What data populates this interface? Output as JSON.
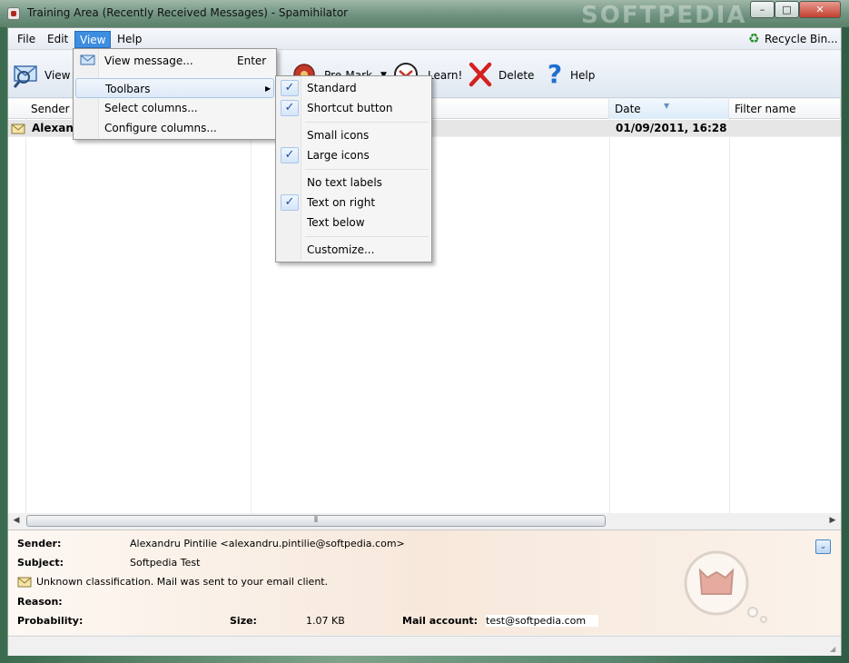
{
  "window": {
    "title": "Training Area (Recently Received Messages) - Spamihilator",
    "watermark": "SOFTPEDIA",
    "minimize_glyph": "–",
    "maximize_glyph": "□",
    "close_glyph": "✕"
  },
  "menubar": {
    "items": [
      "File",
      "Edit",
      "View",
      "Help"
    ],
    "active": "View",
    "recycle_label": "Recycle Bin..."
  },
  "toolbar": {
    "view_label": "View m",
    "premark_label": "Pre-Mark",
    "learn_label": "Learn!",
    "delete_label": "Delete",
    "help_label": "Help"
  },
  "list": {
    "columns": [
      "Sender",
      "Date",
      "Filter name"
    ],
    "sorted_column": "Date",
    "rows": [
      {
        "sender": "Alexand",
        "date": "01/09/2011, 16:28",
        "filter": ""
      }
    ]
  },
  "hscroll": {
    "left_arrow": "◀",
    "right_arrow": "▶",
    "thumb_grip": "⦀"
  },
  "details": {
    "sender_label": "Sender:",
    "sender_value": "Alexandru Pintilie <alexandru.pintilie@softpedia.com>",
    "subject_label": "Subject:",
    "subject_value": "Softpedia Test",
    "classification_text": "Unknown classification. Mail was sent to your email client.",
    "reason_label": "Reason:",
    "probability_label": "Probability:",
    "size_label": "Size:",
    "size_value": "1.07 KB",
    "account_label": "Mail account:",
    "account_value": "test@softpedia.com",
    "expand_glyph": "⌄"
  },
  "view_menu": {
    "items": [
      {
        "label": "View message...",
        "shortcut": "Enter"
      },
      {
        "label": "Toolbars",
        "submenu": true
      },
      {
        "label": "Select columns..."
      },
      {
        "label": "Configure columns..."
      }
    ],
    "submenu_arrow": "▶"
  },
  "toolbars_submenu": {
    "items": [
      {
        "label": "Standard",
        "checked": true
      },
      {
        "label": "Shortcut button",
        "checked": true
      },
      {
        "label": "Small icons",
        "checked": false
      },
      {
        "label": "Large icons",
        "checked": true
      },
      {
        "label": "No text labels",
        "checked": false
      },
      {
        "label": "Text on right",
        "checked": true
      },
      {
        "label": "Text below",
        "checked": false
      },
      {
        "label": "Customize...",
        "checked": false
      }
    ],
    "check_glyph": "✓"
  },
  "colors": {
    "menu_highlight": "#3d8ee0",
    "delete_red": "#d42020",
    "help_blue": "#1f6fd0"
  },
  "icons": [
    "app-icon",
    "recycle-icon",
    "view-message-icon",
    "premark-icon",
    "learn-icon",
    "delete-icon",
    "help-icon",
    "envelope-icon",
    "devil-icon"
  ]
}
